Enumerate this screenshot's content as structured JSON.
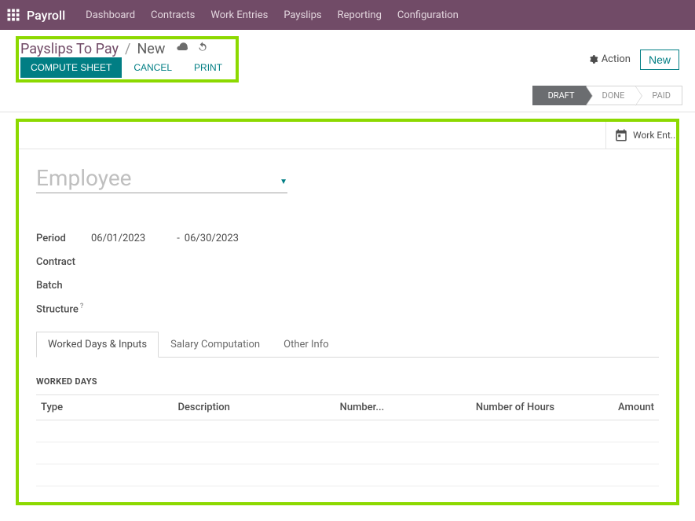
{
  "nav": {
    "brand": "Payroll",
    "items": [
      "Dashboard",
      "Contracts",
      "Work Entries",
      "Payslips",
      "Reporting",
      "Configuration"
    ]
  },
  "breadcrumb": {
    "parent": "Payslips To Pay",
    "current": "New"
  },
  "buttons": {
    "compute": "COMPUTE SHEET",
    "cancel": "CANCEL",
    "print": "PRINT",
    "action": "Action",
    "new": "New"
  },
  "status": {
    "steps": [
      "DRAFT",
      "DONE",
      "PAID"
    ],
    "active_index": 0
  },
  "smart_buttons": {
    "work_entries": "Work Ent..."
  },
  "form": {
    "employee_placeholder": "Employee",
    "labels": {
      "period": "Period",
      "contract": "Contract",
      "batch": "Batch",
      "structure": "Structure"
    },
    "period_from": "06/01/2023",
    "period_to": "06/30/2023"
  },
  "tabs": {
    "worked_days": "Worked Days & Inputs",
    "salary_comp": "Salary Computation",
    "other_info": "Other Info"
  },
  "worked_days": {
    "heading": "WORKED DAYS",
    "columns": {
      "type": "Type",
      "description": "Description",
      "number_days": "Number...",
      "number_hours": "Number of Hours",
      "amount": "Amount"
    }
  }
}
